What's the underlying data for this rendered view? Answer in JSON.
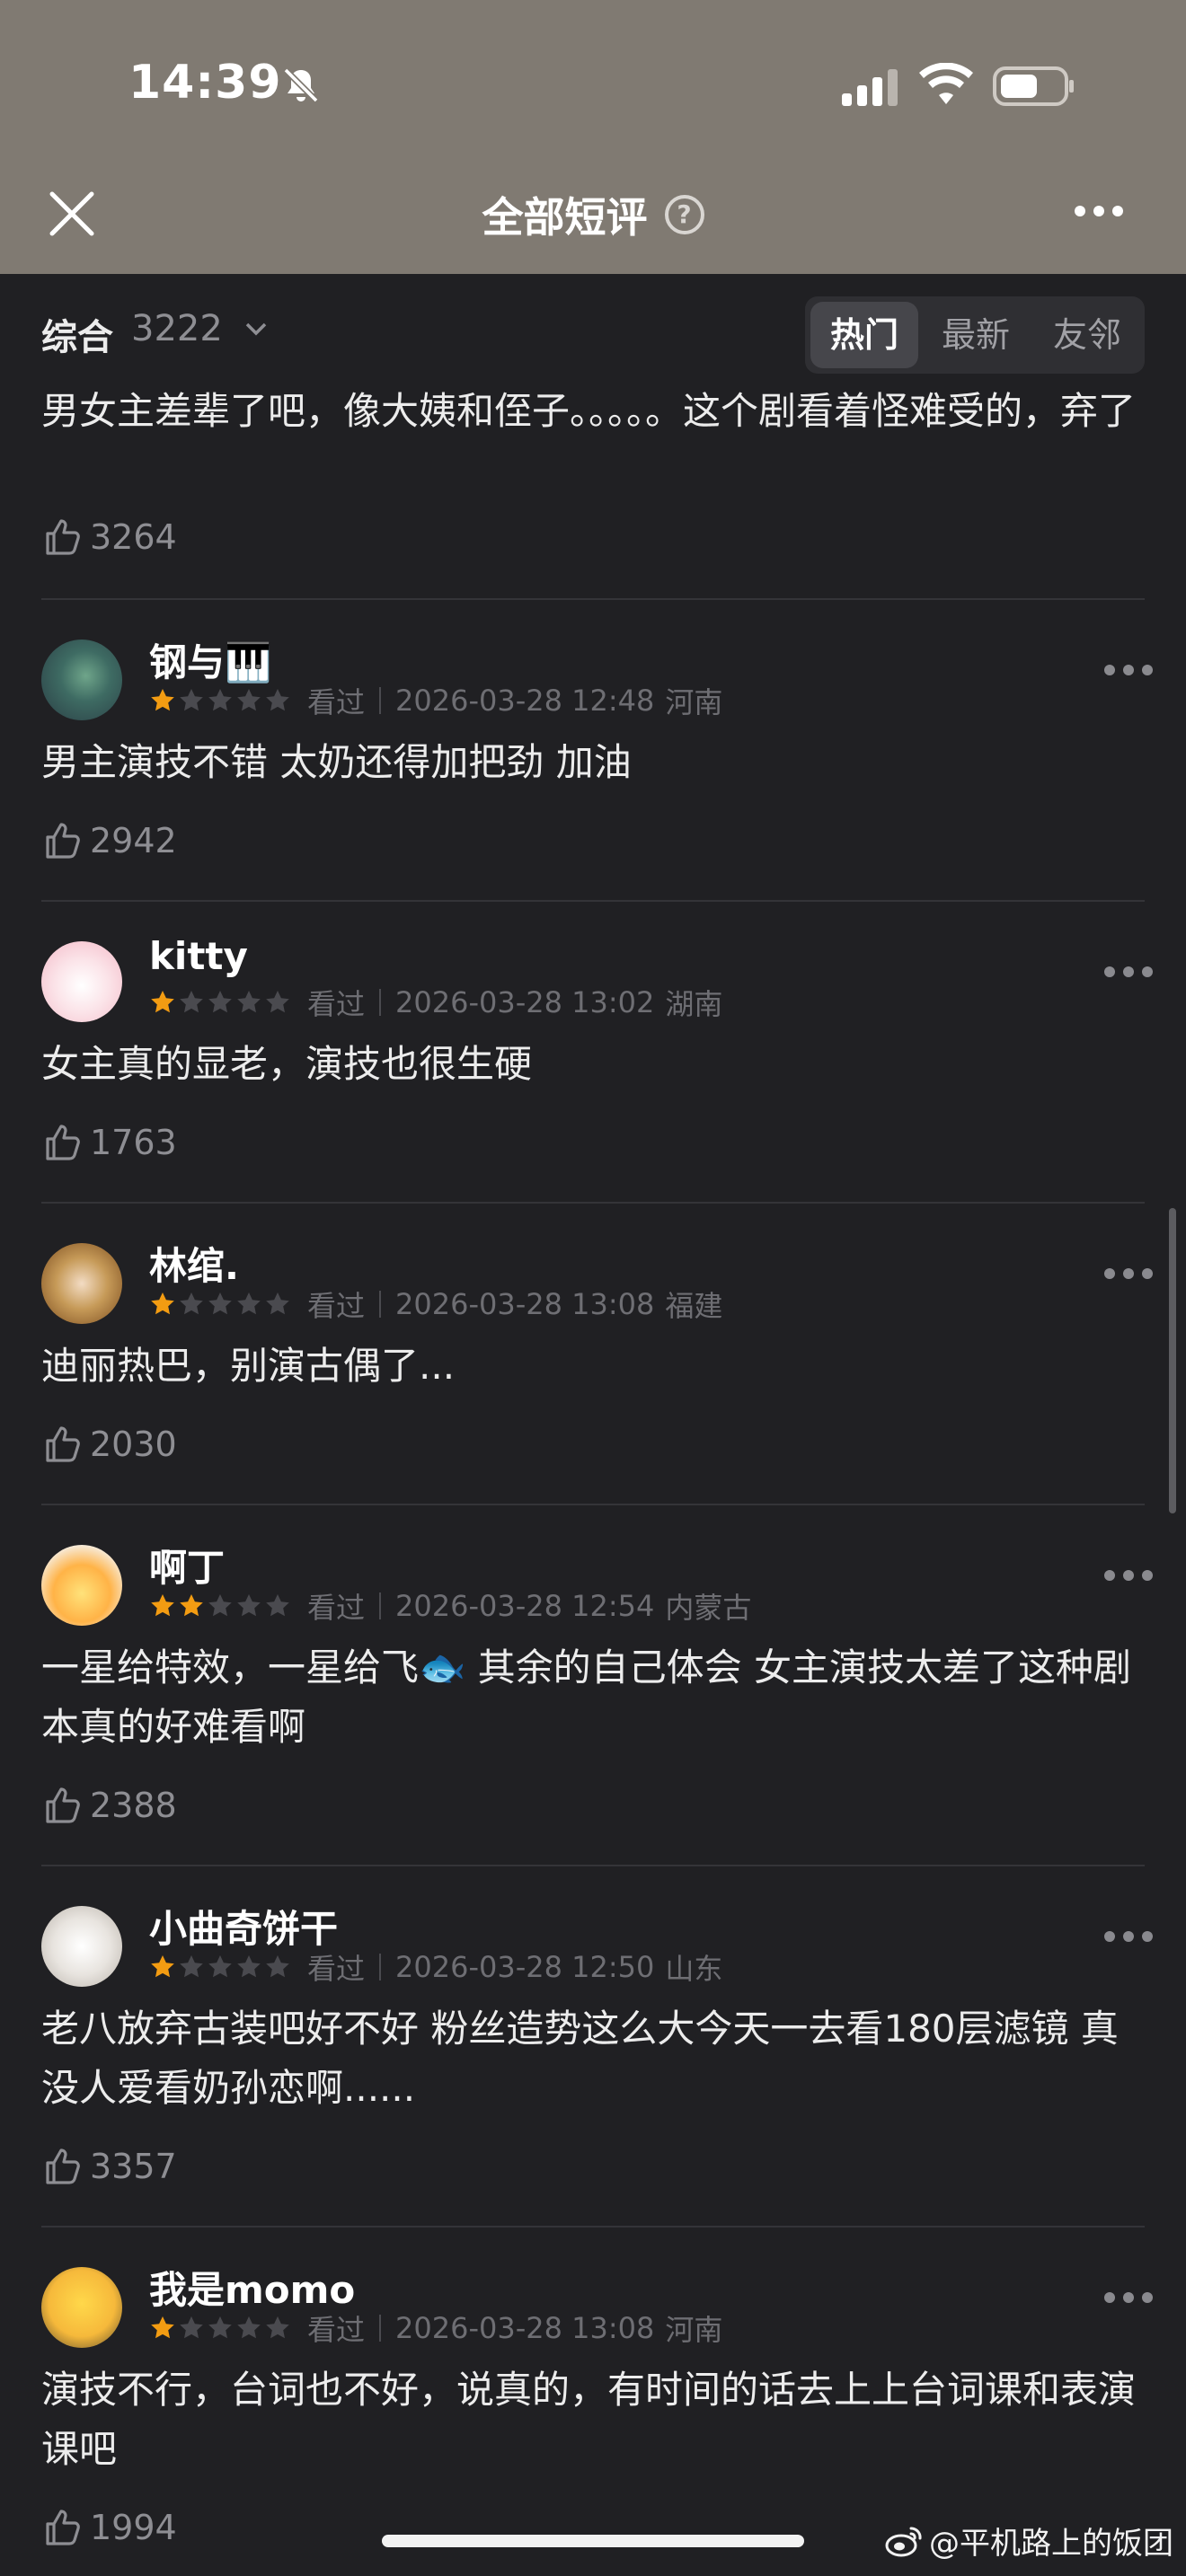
{
  "status_bar": {
    "time": "14:39"
  },
  "nav": {
    "title": "全部短评",
    "help_glyph": "?"
  },
  "filter": {
    "sort_label": "综合",
    "count": "3222",
    "tabs": [
      {
        "label": "热门",
        "active": true
      },
      {
        "label": "最新",
        "active": false
      },
      {
        "label": "友邻",
        "active": false
      }
    ]
  },
  "reviews": [
    {
      "content": "男女主差辈了吧，像大姨和侄子。。。。。这个剧看着怪难受的，弃了",
      "likes": "3264"
    },
    {
      "user": "钢与🎹",
      "rating": 1,
      "watched": "看过",
      "date": "2026-03-28 12:48",
      "location": "河南",
      "content": "男主演技不错 太奶还得加把劲 加油",
      "likes": "2942"
    },
    {
      "user": "kitty",
      "rating": 1,
      "watched": "看过",
      "date": "2026-03-28 13:02",
      "location": "湖南",
      "content": "女主真的显老，演技也很生硬",
      "likes": "1763"
    },
    {
      "user": "林绾.",
      "rating": 1,
      "watched": "看过",
      "date": "2026-03-28 13:08",
      "location": "福建",
      "content": "迪丽热巴，别演古偶了...",
      "likes": "2030"
    },
    {
      "user": "啊丁",
      "rating": 2,
      "watched": "看过",
      "date": "2026-03-28 12:54",
      "location": "内蒙古",
      "content": "一星给特效，一星给飞🐟  其余的自己体会  女主演技太差了这种剧本真的好难看啊",
      "likes": "2388"
    },
    {
      "user": "小曲奇饼干",
      "rating": 1,
      "watched": "看过",
      "date": "2026-03-28 12:50",
      "location": "山东",
      "content": "老八放弃古装吧好不好  粉丝造势这么大今天一去看180层滤镜  真没人爱看奶孙恋啊......",
      "likes": "3357"
    },
    {
      "user": "我是momo",
      "rating": 1,
      "watched": "看过",
      "date": "2026-03-28 13:08",
      "location": "河南",
      "content": "演技不行，台词也不好，说真的，有时间的话去上上台词课和表演课吧",
      "likes": "1994"
    }
  ],
  "watermark": "@平机路上的饭团",
  "colors": {
    "header_bg": "#807a72",
    "page_bg": "#202023",
    "star_on": "#f39c12",
    "star_off": "#4a4a4f"
  }
}
